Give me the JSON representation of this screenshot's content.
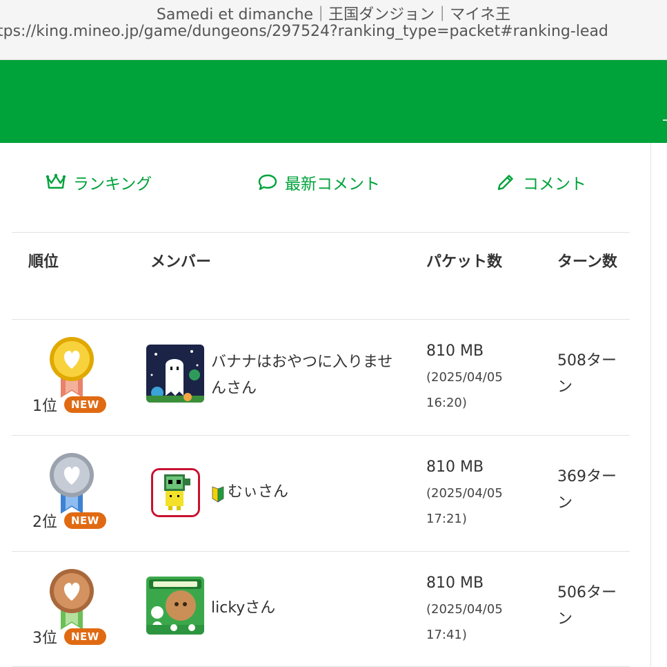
{
  "browser": {
    "title": "Samedi et dimanche｜王国ダンジョン｜マイネ王",
    "url": "tps://king.mineo.jp/game/dungeons/297524?ranking_type=packet#ranking-lead"
  },
  "colors": {
    "brand_green": "#00a23a",
    "new_badge": "#e06a12",
    "highlight_frame": "#c8102e"
  },
  "tabs": [
    {
      "label": "ランキング",
      "icon": "crown-icon"
    },
    {
      "label": "最新コメント",
      "icon": "speech-bubble-icon"
    },
    {
      "label": "コメント",
      "icon": "pencil-icon"
    }
  ],
  "table": {
    "headers": {
      "rank": "順位",
      "member": "メンバー",
      "packet": "パケット数",
      "turns": "ターン数"
    },
    "rows": [
      {
        "rank": "1位",
        "medal": "gold-medal-icon",
        "badge": "NEW",
        "member": "バナナはおやつに入りませんさん",
        "packet": "810 MB",
        "date": "(2025/04/05 16:20)",
        "turns": "508ターン"
      },
      {
        "rank": "2位",
        "medal": "silver-medal-icon",
        "badge": "NEW",
        "member_mark": "beginner-mark-icon",
        "member": "むぃさん",
        "packet": "810 MB",
        "date": "(2025/04/05 17:21)",
        "turns": "369ターン"
      },
      {
        "rank": "3位",
        "medal": "bronze-medal-icon",
        "badge": "NEW",
        "member": "lickyさん",
        "packet": "810 MB",
        "date": "(2025/04/05 17:41)",
        "turns": "506ターン"
      }
    ]
  }
}
